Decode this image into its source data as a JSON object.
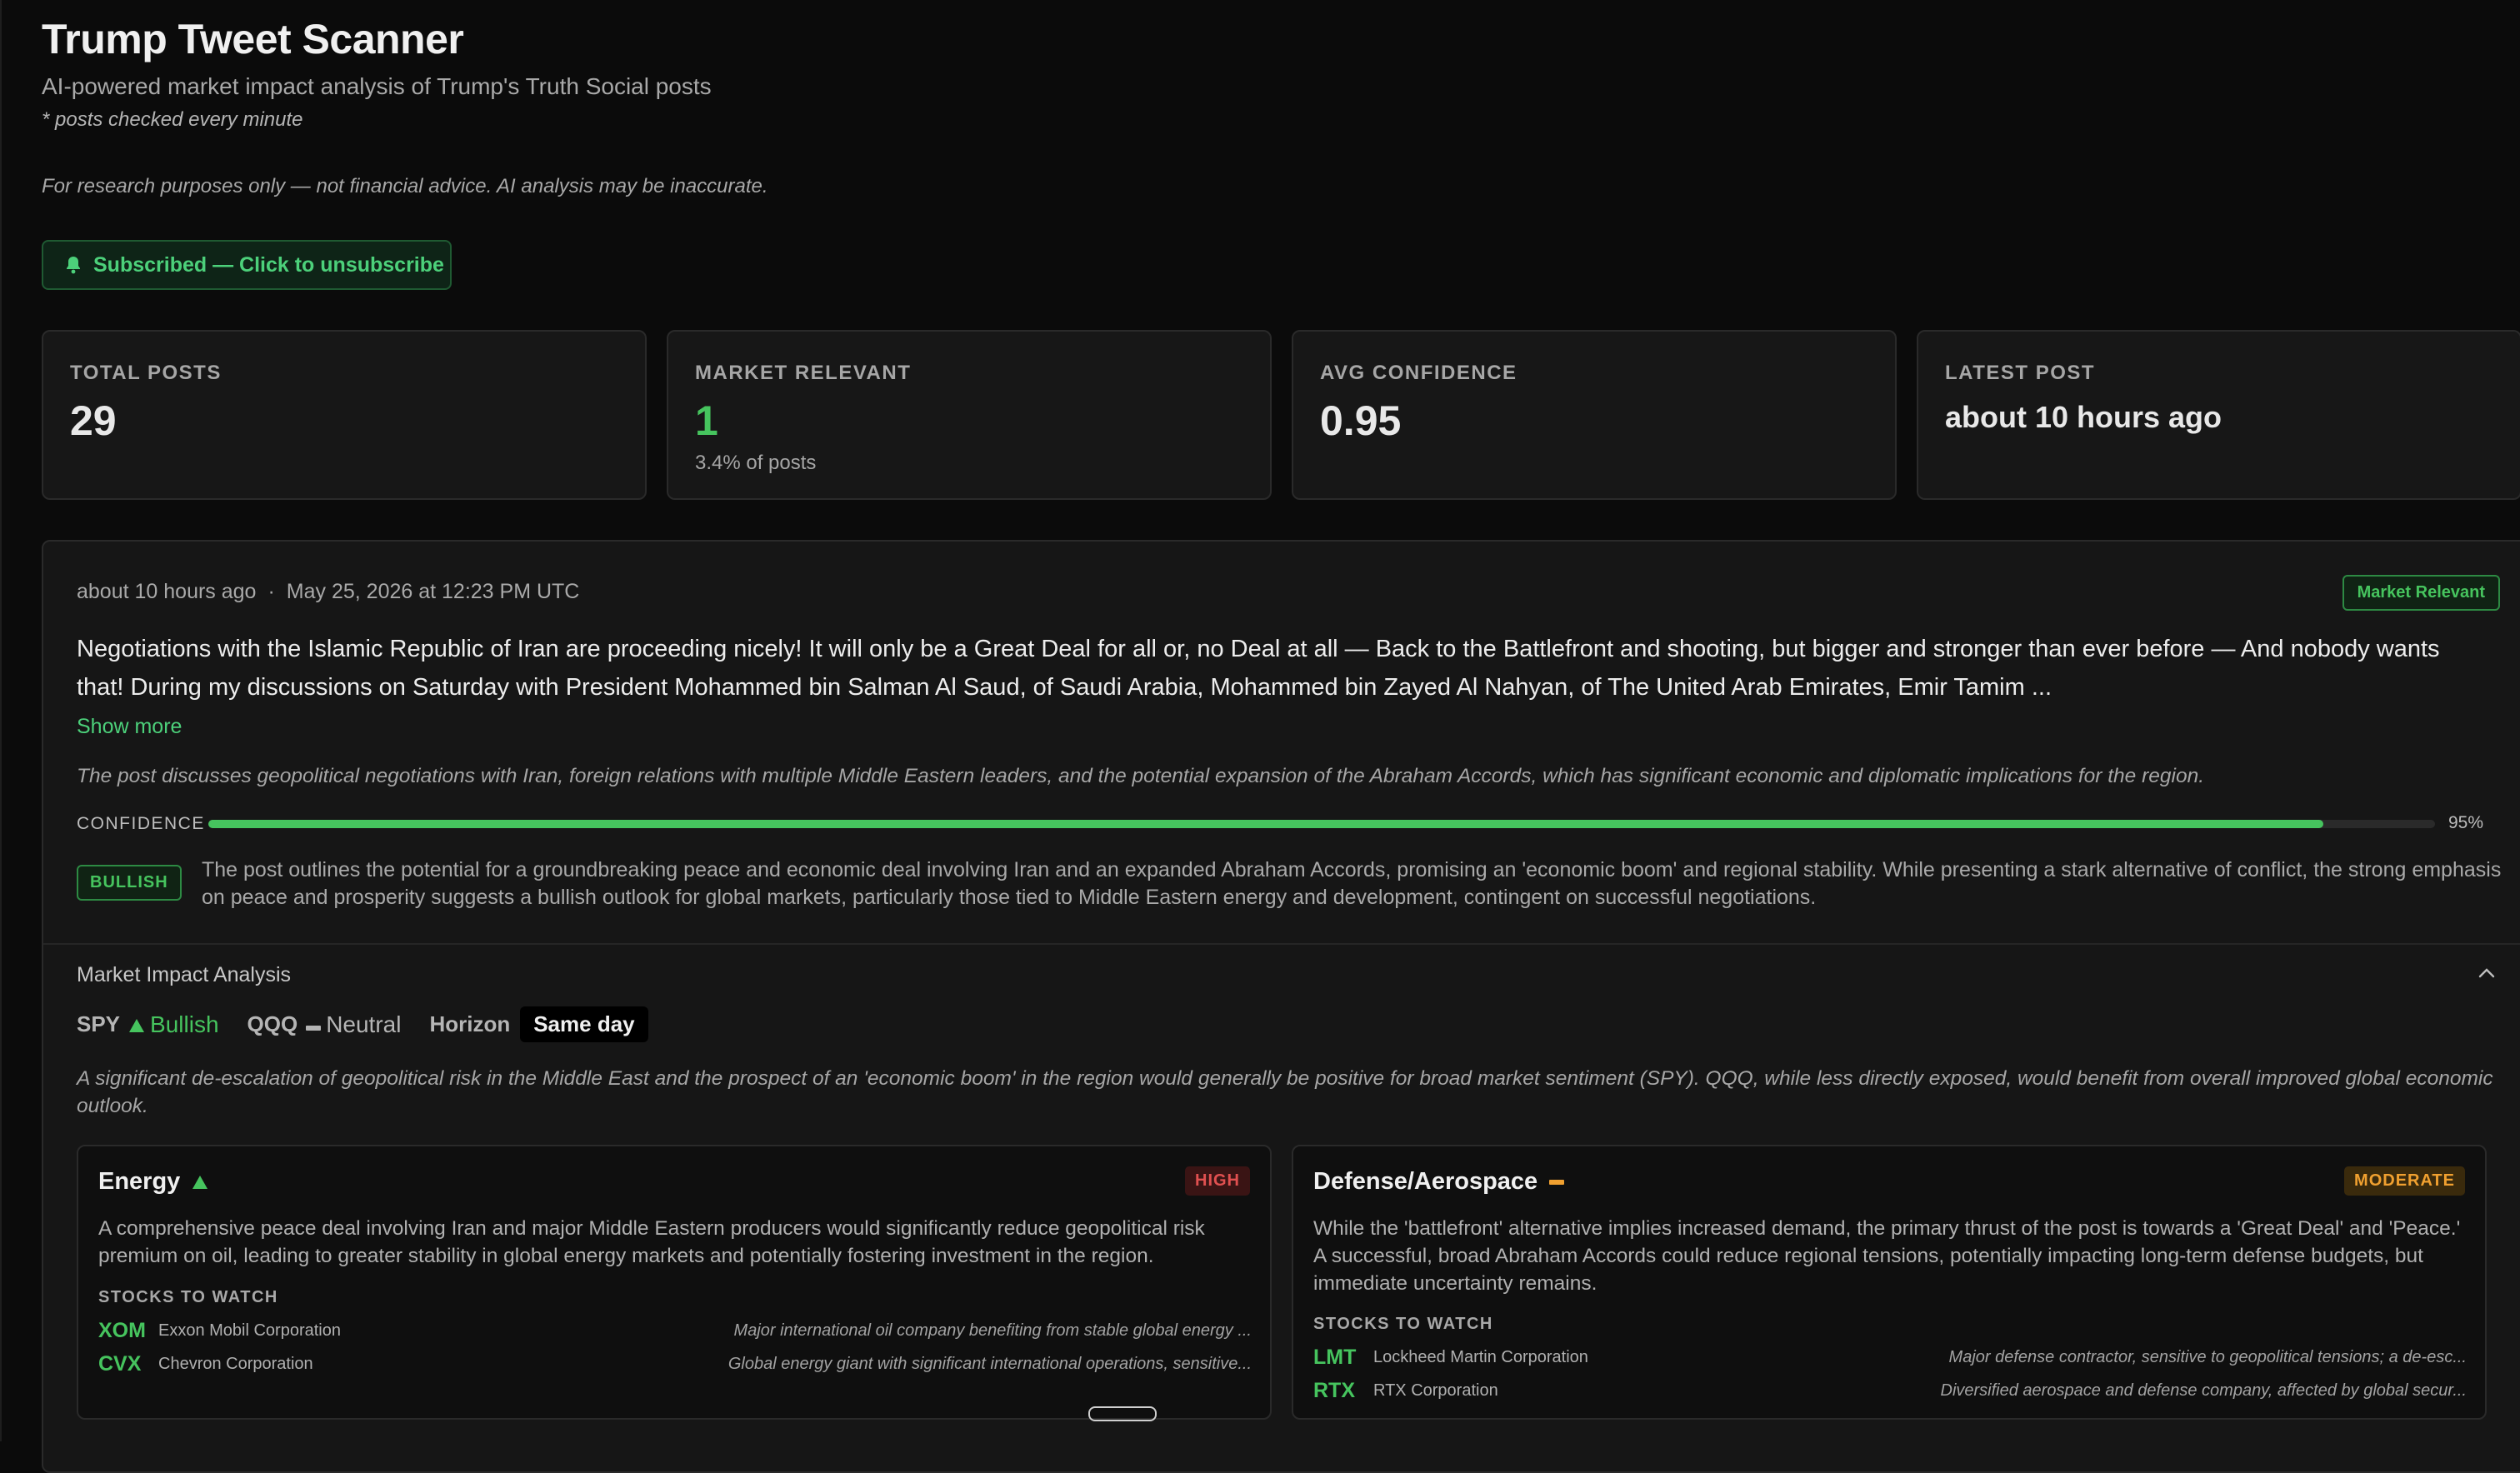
{
  "header": {
    "title": "Trump Tweet Scanner",
    "subtitle": "AI-powered market impact analysis of Trump's Truth Social posts",
    "note": "* posts checked every minute",
    "disclaimer": "For research purposes only — not financial advice. AI analysis may be inaccurate."
  },
  "subscribe": {
    "label": "Subscribed — Click to unsubscribe",
    "icon": "bell-icon"
  },
  "stats": {
    "total_posts": {
      "label": "TOTAL POSTS",
      "value": "29"
    },
    "market_relevant": {
      "label": "MARKET RELEVANT",
      "value": "1",
      "sub": "3.4% of posts"
    },
    "avg_confidence": {
      "label": "AVG CONFIDENCE",
      "value": "0.95"
    },
    "latest_post": {
      "label": "LATEST POST",
      "value": "about 10 hours ago"
    }
  },
  "post": {
    "relative_time": "about 10 hours ago",
    "timestamp": "May 25, 2026 at 12:23 PM UTC",
    "relevance_badge": "Market Relevant",
    "text": "Negotiations with the Islamic Republic of Iran are proceeding nicely! It will only be a Great Deal for all or, no Deal at all — Back to the Battlefront and shooting, but bigger and stronger than ever before — And nobody wants that! During my discussions on Saturday with President Mohammed bin Salman Al Saud, of Saudi Arabia, Mohammed bin Zayed Al Nahyan, of The United Arab Emirates, Emir Tamim ...",
    "show_more": "Show more",
    "summary": "The post discusses geopolitical negotiations with Iran, foreign relations with multiple Middle Eastern leaders, and the potential expansion of the Abraham Accords, which has significant economic and diplomatic implications for the region.",
    "confidence_label": "CONFIDENCE",
    "confidence": 0.95,
    "confidence_text": "95%",
    "sentiment": "BULLISH",
    "sentiment_rationale": "The post outlines the potential for a groundbreaking peace and economic deal involving Iran and an expanded Abraham Accords, promising an 'economic boom' and regional stability. While presenting a stark alternative of conflict, the strong emphasis on peace and prosperity suggests a bullish outlook for global markets, particularly those tied to Middle Eastern energy and development, contingent on successful negotiations."
  },
  "impact": {
    "title": "Market Impact Analysis",
    "spy": {
      "label": "SPY",
      "direction": "Bullish"
    },
    "qqq": {
      "label": "QQQ",
      "direction": "Neutral"
    },
    "horizon_label": "Horizon",
    "horizon": "Same day",
    "note": "A significant de-escalation of geopolitical risk in the Middle East and the prospect of an 'economic boom' in the region would generally be positive for broad market sentiment (SPY). QQQ, while less directly exposed, would benefit from overall improved global economic outlook."
  },
  "sectors": [
    {
      "name": "Energy",
      "impact": "HIGH",
      "description": "A comprehensive peace deal involving Iran and major Middle Eastern producers would significantly reduce geopolitical risk premium on oil, leading to greater stability in global energy markets and potentially fostering investment in the region.",
      "stocks_label": "STOCKS TO WATCH",
      "stocks": [
        {
          "ticker": "XOM",
          "name": "Exxon Mobil Corporation",
          "note": "Major international oil company benefiting from stable global energy ..."
        },
        {
          "ticker": "CVX",
          "name": "Chevron Corporation",
          "note": "Global energy giant with significant international operations, sensitive..."
        }
      ]
    },
    {
      "name": "Defense/Aerospace",
      "impact": "MODERATE",
      "description": "While the 'battlefront' alternative implies increased demand, the primary thrust of the post is towards a 'Great Deal' and 'Peace.' A successful, broad Abraham Accords could reduce regional tensions, potentially impacting long-term defense budgets, but immediate uncertainty remains.",
      "stocks_label": "STOCKS TO WATCH",
      "stocks": [
        {
          "ticker": "LMT",
          "name": "Lockheed Martin Corporation",
          "note": "Major defense contractor, sensitive to geopolitical tensions; a de-esc..."
        },
        {
          "ticker": "RTX",
          "name": "RTX Corporation",
          "note": "Diversified aerospace and defense company, affected by global secur..."
        }
      ]
    }
  ],
  "colors": {
    "accent": "#46c45e",
    "high": "#e05050",
    "moderate": "#f0a030",
    "background": "#0b0b0b"
  }
}
